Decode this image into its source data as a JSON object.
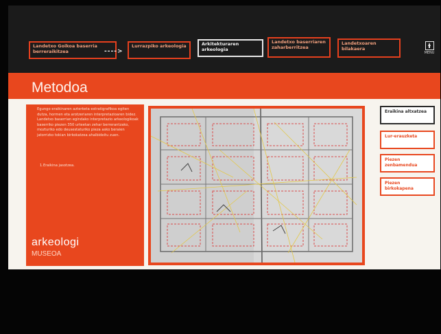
{
  "nav": {
    "items": [
      {
        "label": "Landetxo Goikoa baserria berreraikitzea",
        "state": "normal"
      },
      {
        "label": "Lurrazpiko arkeologia",
        "state": "normal"
      },
      {
        "label": "Arkitekturaren arkeologia",
        "state": "active"
      },
      {
        "label": "Landetxo baserriaren zaharberritzea",
        "state": "normal"
      },
      {
        "label": "Landetxoaren bilakaera",
        "state": "normal"
      }
    ],
    "arrow": "---->",
    "menu_label": "MENU",
    "menu_icon": "up-arrow-icon"
  },
  "section": {
    "title": "Metodoa",
    "body": "Egungo eraikinaren azterketa estratigrafikoa egiten dutza, hormen eta arotzeriaren interpretazioaren bidez. Landetxo baserrian egindako interpretazio arkeologikoak baserriko piezen 350 urteetan zehar berrerantzako, mozturiko edo deusestaturiko pieza asko beraien jatorrizko tokian birkokatzea ahalbideitu zuen.",
    "list_item": "1.Eraikina jasotzea."
  },
  "logo": {
    "line1": "arkeologi",
    "line2": "MUSEOA"
  },
  "side_menu": {
    "items": [
      {
        "label": "Eraikina altxatzea",
        "state": "active"
      },
      {
        "label": "Lur-erauzketa",
        "state": "normal"
      },
      {
        "label": "Piezen zenbamendua",
        "state": "normal"
      },
      {
        "label": "Piezen birkokapena",
        "state": "normal"
      }
    ]
  },
  "colors": {
    "accent": "#e8471e",
    "panel_bg": "#f7f4ee",
    "dark_bg": "#1b1b1b"
  }
}
